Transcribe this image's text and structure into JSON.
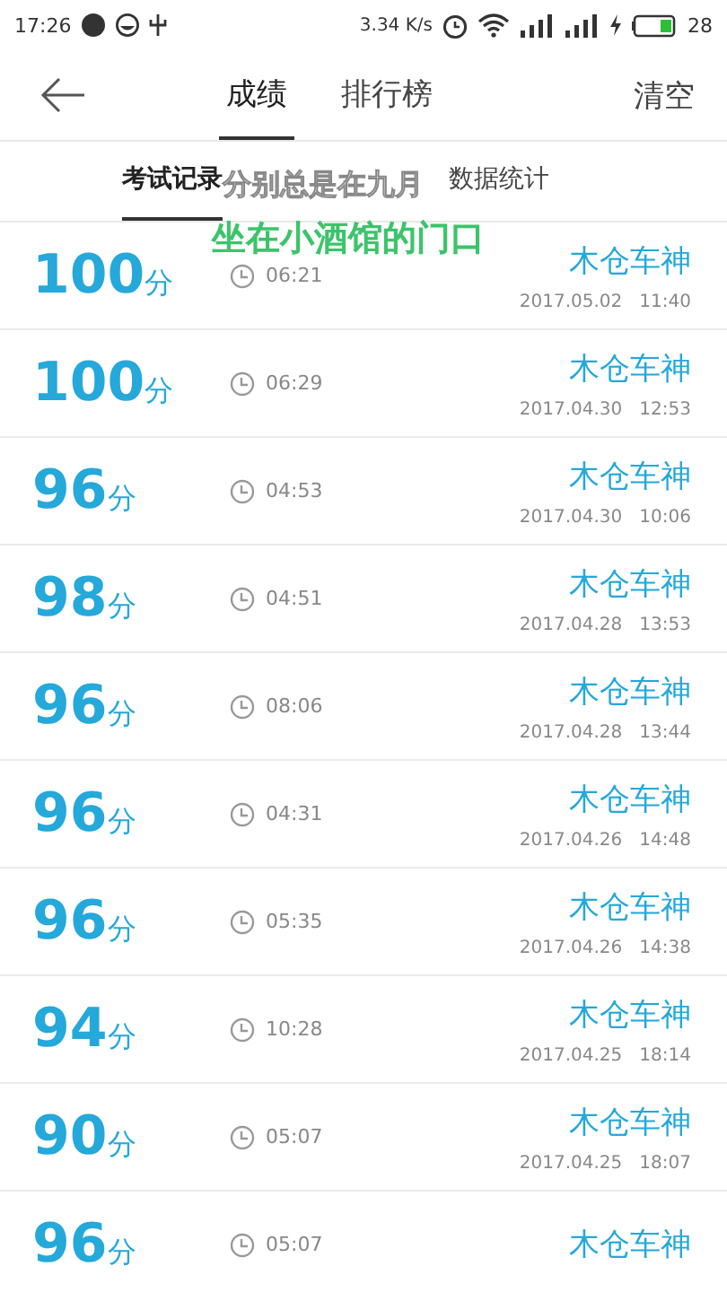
{
  "status_bar": {
    "time": "17:26",
    "speed": "3.34 K/s",
    "battery": "28"
  },
  "header": {
    "tabs": [
      {
        "label": "成绩",
        "selected": true
      },
      {
        "label": "排行榜",
        "selected": false
      }
    ],
    "action": "清空"
  },
  "subtabs": [
    {
      "label": "考试记录",
      "selected": true
    },
    {
      "label": "数据统计",
      "selected": false
    }
  ],
  "lyrics": [
    "分别总是在九月",
    "坐在小酒馆的门口"
  ],
  "records": [
    {
      "score": "100",
      "unit": "分",
      "duration": "06:21",
      "name": "木仓车神",
      "date": "2017.05.02   11:40"
    },
    {
      "score": "100",
      "unit": "分",
      "duration": "06:29",
      "name": "木仓车神",
      "date": "2017.04.30   12:53"
    },
    {
      "score": "96",
      "unit": "分",
      "duration": "04:53",
      "name": "木仓车神",
      "date": "2017.04.30   10:06"
    },
    {
      "score": "98",
      "unit": "分",
      "duration": "04:51",
      "name": "木仓车神",
      "date": "2017.04.28   13:53"
    },
    {
      "score": "96",
      "unit": "分",
      "duration": "08:06",
      "name": "木仓车神",
      "date": "2017.04.28   13:44"
    },
    {
      "score": "96",
      "unit": "分",
      "duration": "04:31",
      "name": "木仓车神",
      "date": "2017.04.26   14:48"
    },
    {
      "score": "96",
      "unit": "分",
      "duration": "05:35",
      "name": "木仓车神",
      "date": "2017.04.26   14:38"
    },
    {
      "score": "94",
      "unit": "分",
      "duration": "10:28",
      "name": "木仓车神",
      "date": "2017.04.25   18:14"
    },
    {
      "score": "90",
      "unit": "分",
      "duration": "05:07",
      "name": "木仓车神",
      "date": "2017.04.25   18:07"
    },
    {
      "score": "96",
      "unit": "分",
      "duration": "05:07",
      "name": "木仓车神"
    }
  ]
}
